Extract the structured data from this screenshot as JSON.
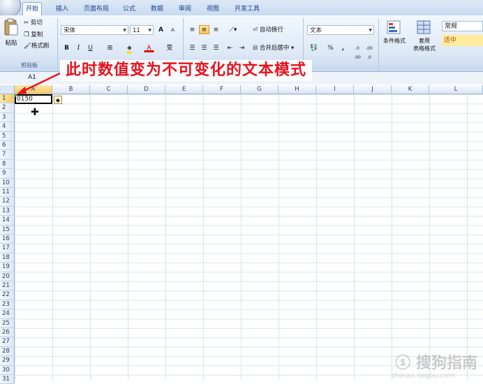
{
  "tabs": [
    "开始",
    "插入",
    "页面布局",
    "公式",
    "数据",
    "审阅",
    "视图",
    "开发工具"
  ],
  "active_tab": "开始",
  "clipboard": {
    "paste": "粘贴",
    "cut": "剪切",
    "copy": "复制",
    "format_painter": "格式刷",
    "group": "剪贴板"
  },
  "font": {
    "name": "宋体",
    "size": "11",
    "bold": "B",
    "italic": "I",
    "underline": "U",
    "grow": "A",
    "shrink": "A",
    "color_letter": "A",
    "phonetic": "变"
  },
  "alignment": {
    "wrap": "自动换行",
    "merge": "合并后居中"
  },
  "number": {
    "format": "文本",
    "percent": "%",
    "comma": ",",
    "inc_dec": ".0 .00",
    "dec_dec": ".00 .0"
  },
  "styles": {
    "conditional": "条件格式",
    "table_top": "套用",
    "table_bottom": "表格格式",
    "normal": "常规",
    "neutral": "适中"
  },
  "name_box": "A1",
  "formula_partial": "150",
  "columns": [
    "A",
    "B",
    "C",
    "D",
    "E",
    "F",
    "G",
    "H",
    "I",
    "J",
    "K",
    "L"
  ],
  "rows": [
    "1",
    "2",
    "3",
    "4",
    "5",
    "6",
    "7",
    "8",
    "9",
    "10",
    "11",
    "12",
    "13",
    "14",
    "15",
    "16",
    "17",
    "18",
    "19",
    "20",
    "21",
    "22",
    "23",
    "24",
    "25",
    "26",
    "27",
    "28",
    "29",
    "30",
    "31"
  ],
  "cell_a1": "0150",
  "annotation": "此时数值变为不可变化的文本模式",
  "watermark": "搜狗指南",
  "watermark_url": "zhinan.sogou.com",
  "colors": {
    "annotation": "#e8121d",
    "ribbon": "#dce8f6",
    "selected_header": "#f7c766"
  }
}
